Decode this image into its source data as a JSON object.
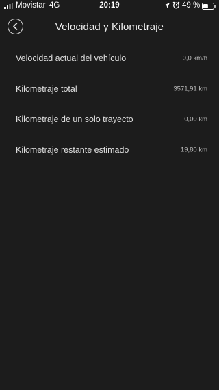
{
  "status_bar": {
    "carrier": "Movistar",
    "network": "4G",
    "time": "20:19",
    "battery_percent": "49 %",
    "signal_bars_active": 2,
    "signal_bars_total": 4,
    "battery_level": 0.49
  },
  "header": {
    "title": "Velocidad y Kilometraje",
    "back_icon": "chevron-left-icon"
  },
  "rows": [
    {
      "label": "Velocidad actual del vehículo",
      "value": "0,0 km/h"
    },
    {
      "label": "Kilometraje total",
      "value": "3571,91 km"
    },
    {
      "label": "Kilometraje de un solo trayecto",
      "value": "0,00 km"
    },
    {
      "label": "Kilometraje restante estimado",
      "value": "19,80 km"
    }
  ],
  "colors": {
    "background": "#1c1c1c",
    "text_primary": "#dedede",
    "text_secondary": "#bdbdbd"
  }
}
